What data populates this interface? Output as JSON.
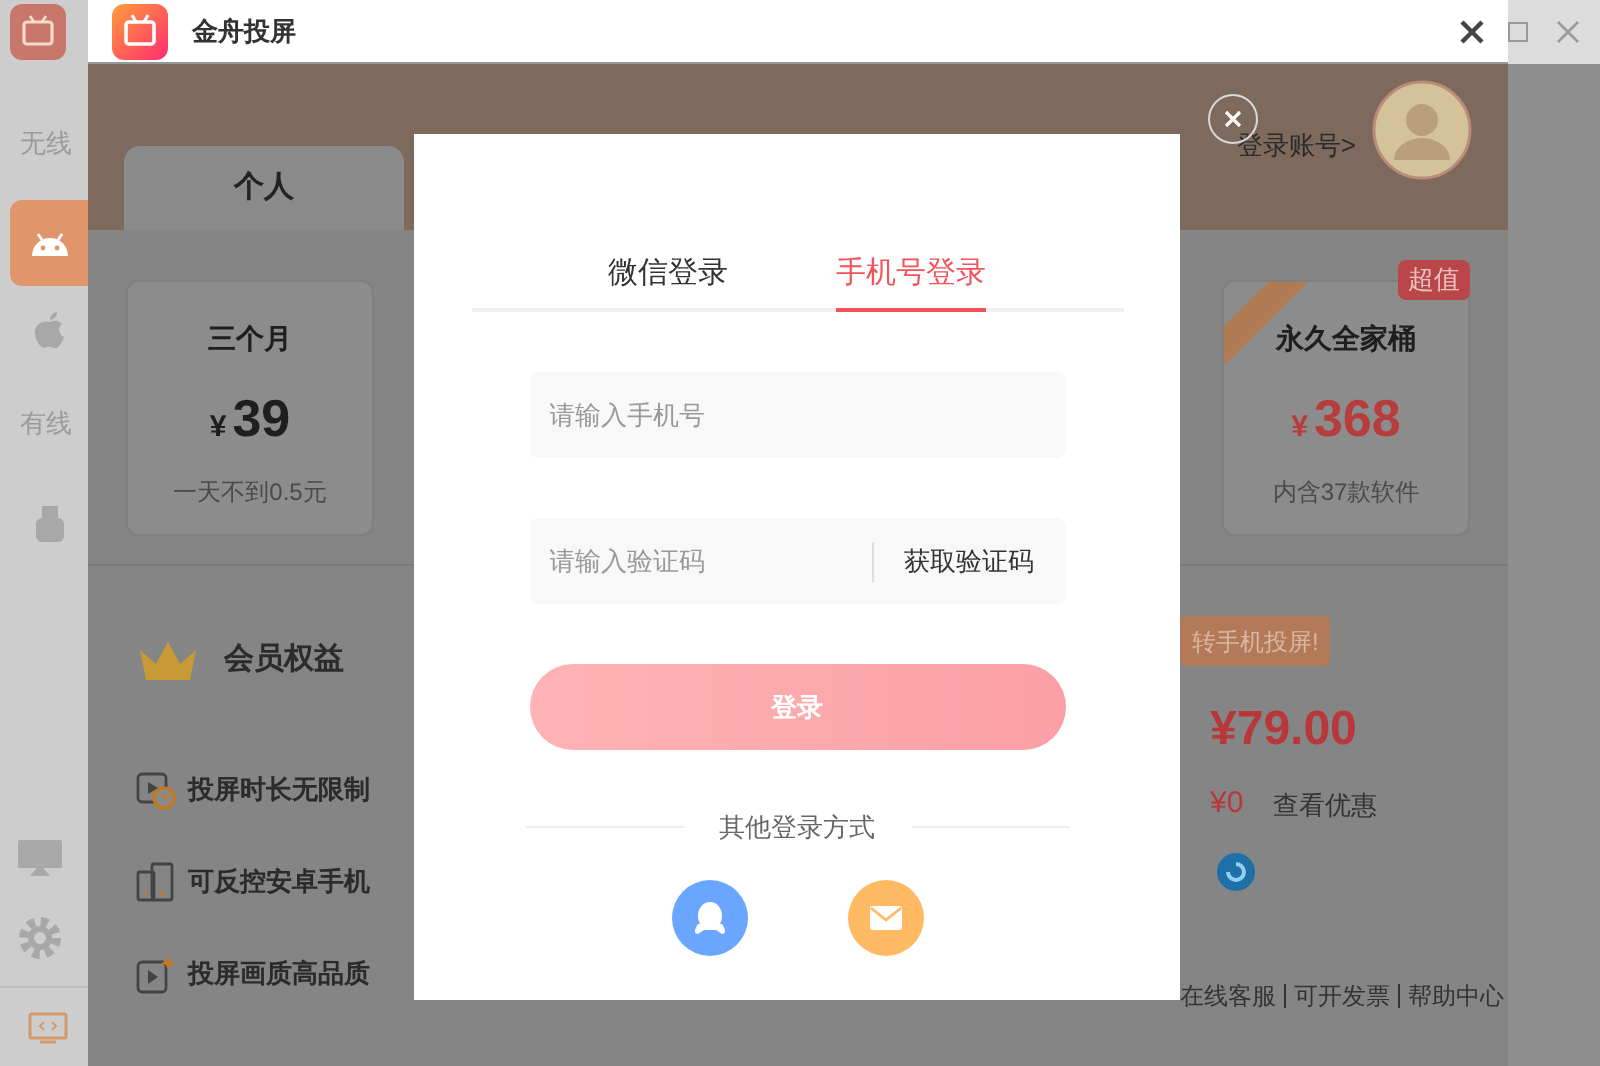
{
  "app": {
    "sidebar": [
      {
        "kind": "label",
        "text": "无线"
      },
      {
        "kind": "android",
        "selected": true
      },
      {
        "kind": "apple",
        "selected": false
      },
      {
        "kind": "label",
        "text": "有线"
      },
      {
        "kind": "usb",
        "selected": false
      }
    ],
    "bottom_icons": [
      {
        "kind": "cast"
      },
      {
        "kind": "gear"
      }
    ]
  },
  "dialog": {
    "title": "金舟投屏",
    "account_link": "登录账号>",
    "plan_tabs": [
      {
        "label": "个人",
        "selected": true
      }
    ],
    "plans": [
      {
        "name": "三个月",
        "currency": "¥",
        "price": "39",
        "note": "一天不到0.5元",
        "selected": false
      },
      {
        "name": "永久全家桶",
        "currency": "¥",
        "price": "368",
        "note": "内含37款软件",
        "badge": "超值",
        "ribbon": true,
        "selected": false
      }
    ],
    "benefits_title": "会员权益",
    "benefits": [
      {
        "kind": "video-clock",
        "text": "投屏时长无限制"
      },
      {
        "kind": "phones",
        "text": "可反控安卓手机"
      },
      {
        "kind": "video-star",
        "text": "投屏画质高品质"
      }
    ],
    "promo": "转手机投屏!",
    "total": "¥79.00",
    "discount": "¥0",
    "discount_link": "查看优惠",
    "footer_links": [
      "在线客服",
      "可开发票",
      "帮助中心"
    ]
  },
  "login": {
    "tabs": [
      {
        "label": "微信登录",
        "selected": false
      },
      {
        "label": "手机号登录",
        "selected": true
      }
    ],
    "phone": {
      "placeholder": "请输入手机号"
    },
    "code": {
      "placeholder": "请输入验证码"
    },
    "get_code": "获取验证码",
    "submit": "登录",
    "other": "其他登录方式",
    "methods": [
      {
        "kind": "qq",
        "color": "#6aa6ff"
      },
      {
        "kind": "email",
        "color": "#ffba63"
      }
    ]
  }
}
